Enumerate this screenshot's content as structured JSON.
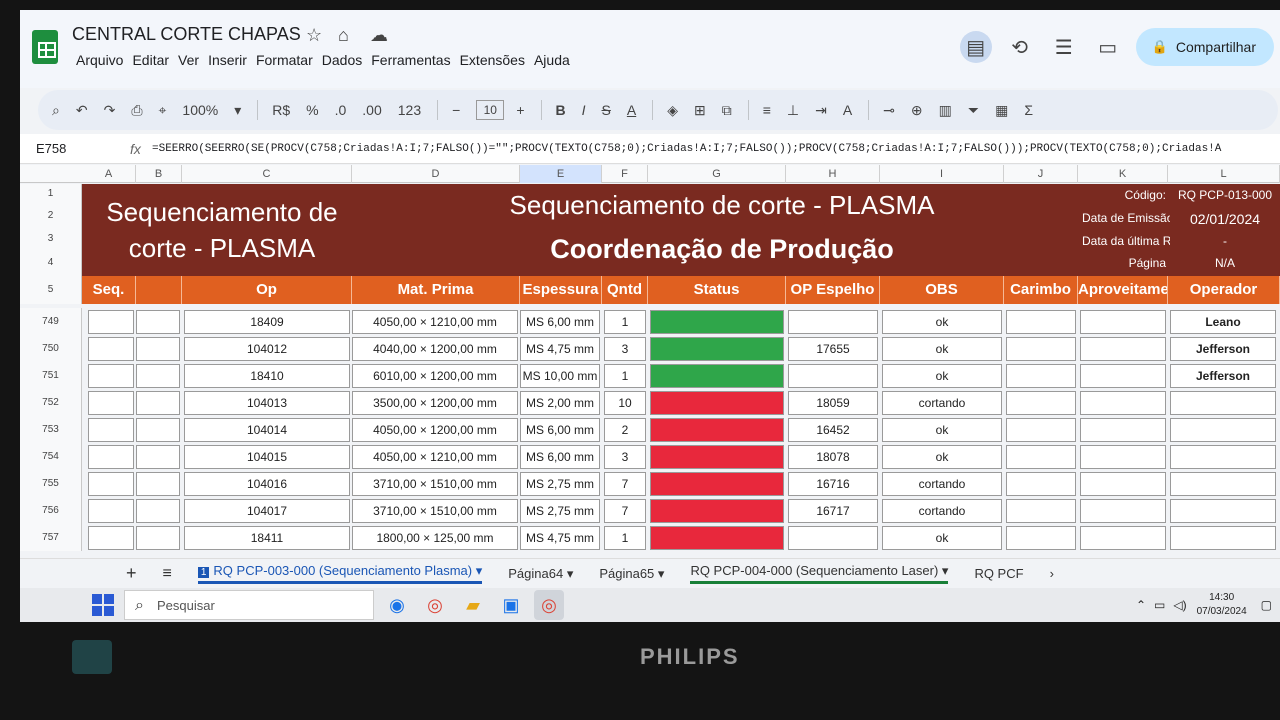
{
  "app": {
    "doc_title": "CENTRAL CORTE CHAPAS",
    "menu": [
      "Arquivo",
      "Editar",
      "Ver",
      "Inserir",
      "Formatar",
      "Dados",
      "Ferramentas",
      "Extensões",
      "Ajuda"
    ],
    "share_label": "Compartilhar"
  },
  "toolbar": {
    "zoom": "100%",
    "currency": "R$",
    "percent": "%",
    "dec_decrease": ".0",
    "dec_increase": ".00",
    "number_format": "123",
    "font_size": "10",
    "bold": "B",
    "italic": "I"
  },
  "formula_bar": {
    "cell_ref": "E758",
    "formula": "=SEERRO(SEERRO(SE(PROCV(C758;Criadas!A:I;7;FALSO())=\"\";PROCV(TEXTO(C758;0);Criadas!A:I;7;FALSO());PROCV(C758;Criadas!A:I;7;FALSO()));PROCV(TEXTO(C758;0);Criadas!A"
  },
  "columns": [
    "A",
    "B",
    "C",
    "D",
    "E",
    "F",
    "G",
    "H",
    "I",
    "J",
    "K",
    "L"
  ],
  "banner": {
    "left_title": "Sequenciamento de corte - PLASMA",
    "subtitle": "Sequenciamento de corte - PLASMA",
    "title": "Coordenação de Produção",
    "codigo_label": "Código:",
    "codigo_value": "RQ PCP-013-000",
    "emissao_label": "Data de Emissão",
    "emissao_value": "02/01/2024",
    "revisao_label": "Data da última Rev",
    "revisao_value": "-",
    "pagina_label": "Página",
    "pagina_value": "N/A"
  },
  "header_rows": [
    "1",
    "2",
    "3",
    "4",
    "5"
  ],
  "headers": [
    "Seq.",
    "",
    "Op",
    "Mat. Prima",
    "Espessura",
    "Qntd",
    "Status",
    "OP Espelho",
    "OBS",
    "Carimbo",
    "Aproveitamento",
    "Operador"
  ],
  "rows": [
    {
      "num": "749",
      "op": "18409",
      "mat": "4050,00 × 1210,00 mm",
      "esp": "MS 6,00 mm",
      "qtd": "1",
      "status": "green",
      "espelho": "",
      "obs": "ok",
      "operador": "Leano"
    },
    {
      "num": "750",
      "op": "104012",
      "mat": "4040,00 × 1200,00 mm",
      "esp": "MS 4,75 mm",
      "qtd": "3",
      "status": "green",
      "espelho": "17655",
      "obs": "ok",
      "operador": "Jefferson"
    },
    {
      "num": "751",
      "op": "18410",
      "mat": "6010,00 × 1200,00 mm",
      "esp": "MS 10,00 mm",
      "qtd": "1",
      "status": "green",
      "espelho": "",
      "obs": "ok",
      "operador": "Jefferson"
    },
    {
      "num": "752",
      "op": "104013",
      "mat": "3500,00 × 1200,00 mm",
      "esp": "MS 2,00 mm",
      "qtd": "10",
      "status": "red",
      "espelho": "18059",
      "obs": "cortando",
      "operador": ""
    },
    {
      "num": "753",
      "op": "104014",
      "mat": "4050,00 × 1200,00 mm",
      "esp": "MS 6,00 mm",
      "qtd": "2",
      "status": "red",
      "espelho": "16452",
      "obs": "ok",
      "operador": ""
    },
    {
      "num": "754",
      "op": "104015",
      "mat": "4050,00 × 1210,00 mm",
      "esp": "MS 6,00 mm",
      "qtd": "3",
      "status": "red",
      "espelho": "18078",
      "obs": "ok",
      "operador": ""
    },
    {
      "num": "755",
      "op": "104016",
      "mat": "3710,00 × 1510,00 mm",
      "esp": "MS 2,75 mm",
      "qtd": "7",
      "status": "red",
      "espelho": "16716",
      "obs": "cortando",
      "operador": ""
    },
    {
      "num": "756",
      "op": "104017",
      "mat": "3710,00 × 1510,00 mm",
      "esp": "MS 2,75 mm",
      "qtd": "7",
      "status": "red",
      "espelho": "16717",
      "obs": "cortando",
      "operador": ""
    },
    {
      "num": "757",
      "op": "18411",
      "mat": "1800,00 × 125,00 mm",
      "esp": "MS 4,75 mm",
      "qtd": "1",
      "status": "red",
      "espelho": "",
      "obs": "ok",
      "operador": ""
    }
  ],
  "sheet_tabs": [
    {
      "num": "1",
      "label": "RQ PCP-003-000 (Sequenciamento Plasma)"
    },
    {
      "label": "Página64"
    },
    {
      "label": "Página65"
    },
    {
      "label": "RQ PCP-004-000 (Sequenciamento Laser)"
    },
    {
      "label": "RQ PCF"
    }
  ],
  "taskbar": {
    "search_placeholder": "Pesquisar",
    "time": "14:30",
    "date": "07/03/2024"
  },
  "monitor_brand": "PHILIPS",
  "colors": {
    "banner": "#7a2a20",
    "header_orange": "#e06020",
    "status_green": "#2fa64a",
    "status_red": "#e8283c",
    "share_button": "#c2e7ff"
  }
}
